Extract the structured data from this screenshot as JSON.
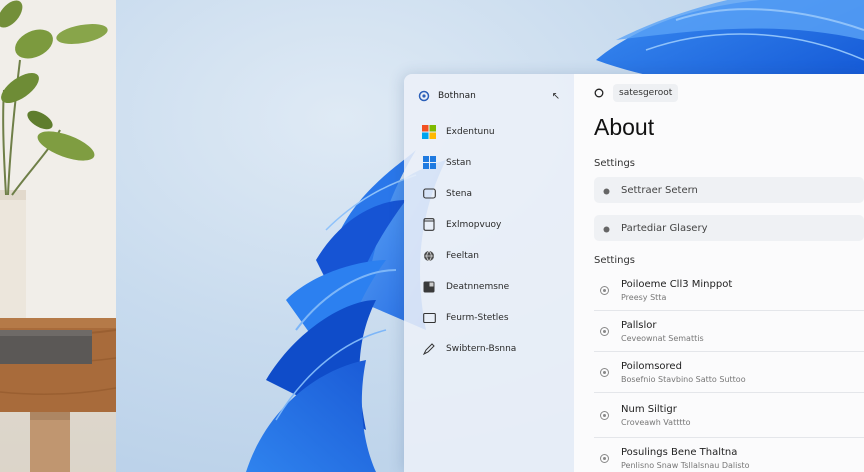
{
  "nav": {
    "header_title": "Bothnan",
    "items": [
      {
        "label": "Exdentunu",
        "icon": "windows-logo-icon"
      },
      {
        "label": "Sstan",
        "icon": "windows-grid-icon"
      },
      {
        "label": "Stena",
        "icon": "display-icon"
      },
      {
        "label": "Exlmopvuoy",
        "icon": "phone-icon"
      },
      {
        "label": "Feeltan",
        "icon": "globe-icon"
      },
      {
        "label": "Deatnnemsne",
        "icon": "apps-icon"
      },
      {
        "label": "Feurm-Stetles",
        "icon": "folder-icon"
      },
      {
        "label": "Swibtern-Bsnna",
        "icon": "pen-icon"
      }
    ]
  },
  "main": {
    "search_value": "satesgeroot",
    "title": "About",
    "section1": "Settings",
    "fields": [
      {
        "label": "Settraer Setern"
      },
      {
        "label": "Partediar Glasery"
      }
    ],
    "section2": "Settings",
    "rows": [
      {
        "title": "Poiloeme Cll3 Minppot",
        "subtitle": "Preesy Stta"
      },
      {
        "title": "Pallslor",
        "subtitle": "Ceveownat Semattis"
      },
      {
        "title": "Poilomsored",
        "subtitle": "Bosefnio Stavbino Satto Suttoo"
      },
      {
        "title": "Num Siltigr",
        "subtitle": "Croveawh Vatttto"
      },
      {
        "title": "Posulings Bene Thaltna",
        "subtitle": "Penlisno Snaw Tsllalsnau Dalisto"
      }
    ]
  }
}
